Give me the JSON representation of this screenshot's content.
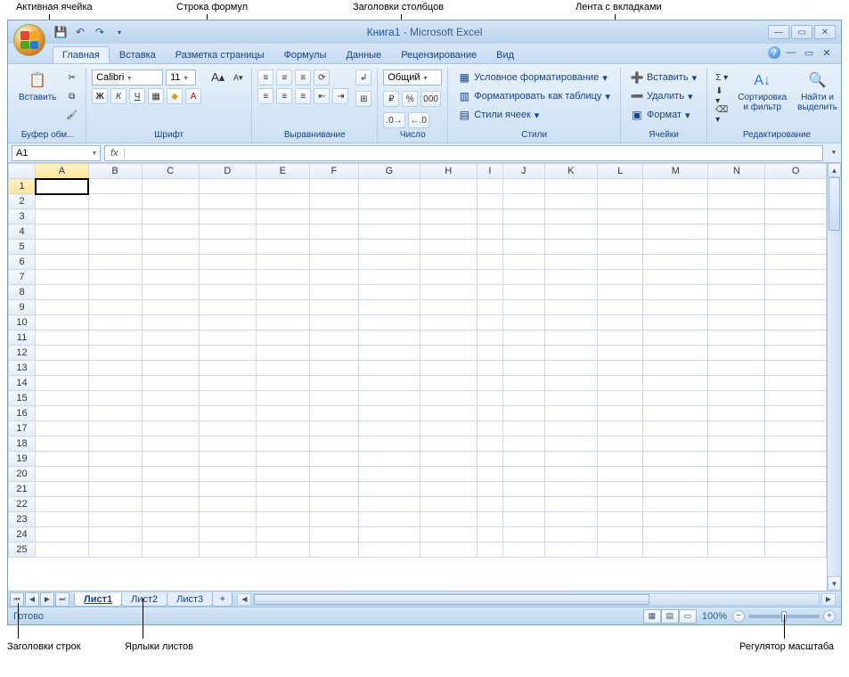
{
  "callouts": {
    "active_cell": "Активная ячейка",
    "formula_bar": "Строка формул",
    "col_headers": "Заголовки столбцов",
    "ribbon": "Лента с вкладками",
    "row_headers": "Заголовки строк",
    "sheet_tabs": "Ярлыки листов",
    "zoom": "Регулятор масштаба"
  },
  "title": {
    "doc": "Книга1",
    "sep": " - ",
    "app": "Microsoft Excel"
  },
  "tabs": [
    "Главная",
    "Вставка",
    "Разметка страницы",
    "Формулы",
    "Данные",
    "Рецензирование",
    "Вид"
  ],
  "ribbon_groups": {
    "clipboard": {
      "paste": "Вставить",
      "label": "Буфер обм..."
    },
    "font": {
      "name": "Calibri",
      "size": "11",
      "label": "Шрифт",
      "bold": "Ж",
      "italic": "К",
      "underline": "Ч",
      "grow": "A",
      "shrink": "A"
    },
    "alignment": {
      "label": "Выравнивание"
    },
    "number": {
      "format": "Общий",
      "label": "Число"
    },
    "styles": {
      "cond": "Условное форматирование",
      "table": "Форматировать как таблицу",
      "cell": "Стили ячеек",
      "label": "Стили"
    },
    "cells": {
      "insert": "Вставить",
      "delete": "Удалить",
      "format": "Формат",
      "label": "Ячейки"
    },
    "editing": {
      "sort": "Сортировка и фильтр",
      "find": "Найти и выделить",
      "label": "Редактирование"
    }
  },
  "name_box": "A1",
  "fx_label": "fx",
  "columns": [
    "A",
    "B",
    "C",
    "D",
    "E",
    "F",
    "G",
    "H",
    "I",
    "J",
    "K",
    "L",
    "M",
    "N",
    "O"
  ],
  "rows": [
    "1",
    "2",
    "3",
    "4",
    "5",
    "6",
    "7",
    "8",
    "9",
    "10",
    "11",
    "12",
    "13",
    "14",
    "15",
    "16",
    "17",
    "18",
    "19",
    "20",
    "21",
    "22",
    "23",
    "24",
    "25"
  ],
  "sheets": [
    "Лист1",
    "Лист2",
    "Лист3"
  ],
  "status": {
    "ready": "Готово",
    "zoom": "100%"
  }
}
